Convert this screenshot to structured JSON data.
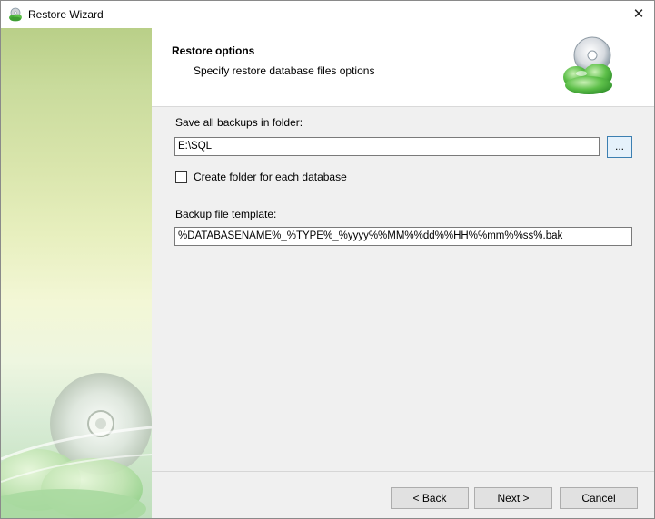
{
  "window": {
    "title": "Restore Wizard",
    "close_glyph": "✕",
    "app_icon": "cloud-disc-icon"
  },
  "header": {
    "title": "Restore options",
    "subtitle": "Specify restore database files options",
    "icon": "cloud-disc-icon"
  },
  "form": {
    "folder_label": "Save all backups in folder:",
    "folder_value": "E:\\SQL",
    "browse_label": "...",
    "create_folder_label": "Create folder for each database",
    "create_folder_checked": false,
    "template_label": "Backup file template:",
    "template_value": "%DATABASENAME%_%TYPE%_%yyyy%%MM%%dd%%HH%%mm%%ss%.bak"
  },
  "footer": {
    "back_label": "< Back",
    "next_label": "Next >",
    "cancel_label": "Cancel"
  },
  "colors": {
    "accent": "#3c7fb1",
    "banner_green": "#b9cf88",
    "cloud_green": "#5ec04a"
  }
}
